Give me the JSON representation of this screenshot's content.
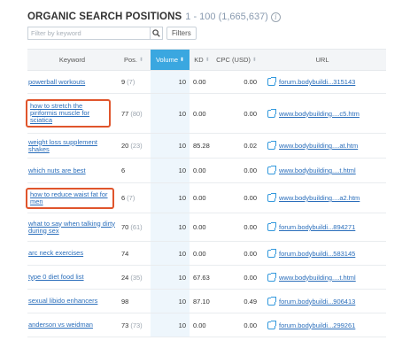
{
  "header": {
    "title": "ORGANIC SEARCH POSITIONS",
    "range": "1 - 100 (1,665,637)",
    "info_glyph": "i"
  },
  "filter": {
    "placeholder": "Filter by keyword",
    "filters_label": "Filters"
  },
  "columns": [
    {
      "label": "Keyword"
    },
    {
      "label": "Pos."
    },
    {
      "label": "Volume"
    },
    {
      "label": "KD"
    },
    {
      "label": "CPC (USD)"
    },
    {
      "label": "URL"
    }
  ],
  "sort_glyph": "⬍",
  "rows": [
    {
      "keyword": "powerball workouts",
      "pos": "9",
      "prev": "(7)",
      "volume": "10",
      "kd": "0.00",
      "cpc": "0.00",
      "url": "forum.bodybuildi...315143"
    },
    {
      "keyword": "how to stretch the piriformis muscle for sciatica",
      "pos": "77",
      "prev": "(80)",
      "volume": "10",
      "kd": "0.00",
      "cpc": "0.00",
      "url": "www.bodybuilding....c5.htm"
    },
    {
      "keyword": "weight loss supplement shakes",
      "pos": "20",
      "prev": "(23)",
      "volume": "10",
      "kd": "85.28",
      "cpc": "0.02",
      "url": "www.bodybuilding....at.htm"
    },
    {
      "keyword": "which nuts are best",
      "pos": "6",
      "prev": "",
      "volume": "10",
      "kd": "0.00",
      "cpc": "0.00",
      "url": "www.bodybuilding....t.html"
    },
    {
      "keyword": "how to reduce waist fat for men",
      "pos": "6",
      "prev": "(7)",
      "volume": "10",
      "kd": "0.00",
      "cpc": "0.00",
      "url": "www.bodybuilding....a2.htm"
    },
    {
      "keyword": "what to say when talking dirty during sex",
      "pos": "70",
      "prev": "(61)",
      "volume": "10",
      "kd": "0.00",
      "cpc": "0.00",
      "url": "forum.bodybuildi...894271"
    },
    {
      "keyword": "arc neck exercises",
      "pos": "74",
      "prev": "",
      "volume": "10",
      "kd": "0.00",
      "cpc": "0.00",
      "url": "forum.bodybuildi...583145"
    },
    {
      "keyword": "type 0 diet food list",
      "pos": "24",
      "prev": "(35)",
      "volume": "10",
      "kd": "67.63",
      "cpc": "0.00",
      "url": "www.bodybuilding....t.html"
    },
    {
      "keyword": "sexual libido enhancers",
      "pos": "98",
      "prev": "",
      "volume": "10",
      "kd": "87.10",
      "cpc": "0.49",
      "url": "forum.bodybuildi...906413"
    },
    {
      "keyword": "anderson vs weidman",
      "pos": "73",
      "prev": "(73)",
      "volume": "10",
      "kd": "0.00",
      "cpc": "0.00",
      "url": "forum.bodybuildi...299261"
    }
  ],
  "colors": {
    "accent": "#3aa7e0",
    "link": "#2a6ebb",
    "highlight": "#e0552c"
  }
}
